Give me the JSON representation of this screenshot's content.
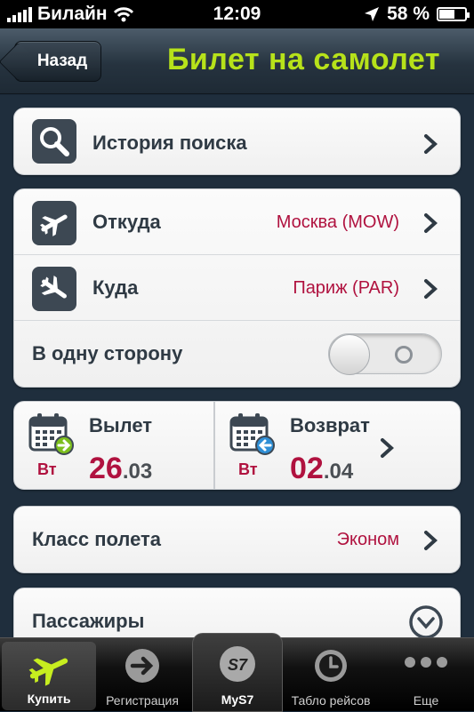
{
  "status_bar": {
    "carrier": "Билайн",
    "time": "12:09",
    "battery": "58 %"
  },
  "nav": {
    "back_label": "Назад",
    "title": "Билет на самолет"
  },
  "history": {
    "label": "История поиска"
  },
  "route": {
    "from_label": "Откуда",
    "from_value": "Москва (MOW)",
    "to_label": "Куда",
    "to_value": "Париж (PAR)",
    "oneway_label": "В одну сторону"
  },
  "dates": {
    "depart_label": "Вылет",
    "depart_dow": "Вт",
    "depart_day": "26",
    "depart_month": ".03",
    "return_label": "Возврат",
    "return_dow": "Вт",
    "return_day": "02",
    "return_month": ".04"
  },
  "flight_class": {
    "label": "Класс полета",
    "value": "Эконом"
  },
  "passengers": {
    "label": "Пассажиры"
  },
  "tabs": [
    {
      "label": "Купить",
      "icon": "plane-icon"
    },
    {
      "label": "Регистрация",
      "icon": "arrow-right-circle-icon"
    },
    {
      "label": "MyS7",
      "icon": "s7-logo-icon"
    },
    {
      "label": "Табло рейсов",
      "icon": "clock-icon"
    },
    {
      "label": "Еще",
      "icon": "more-dots-icon"
    }
  ],
  "colors": {
    "accent_title": "#b7e21a",
    "value_red": "#b0123f",
    "tab_active_icon": "#c7ee1f"
  }
}
